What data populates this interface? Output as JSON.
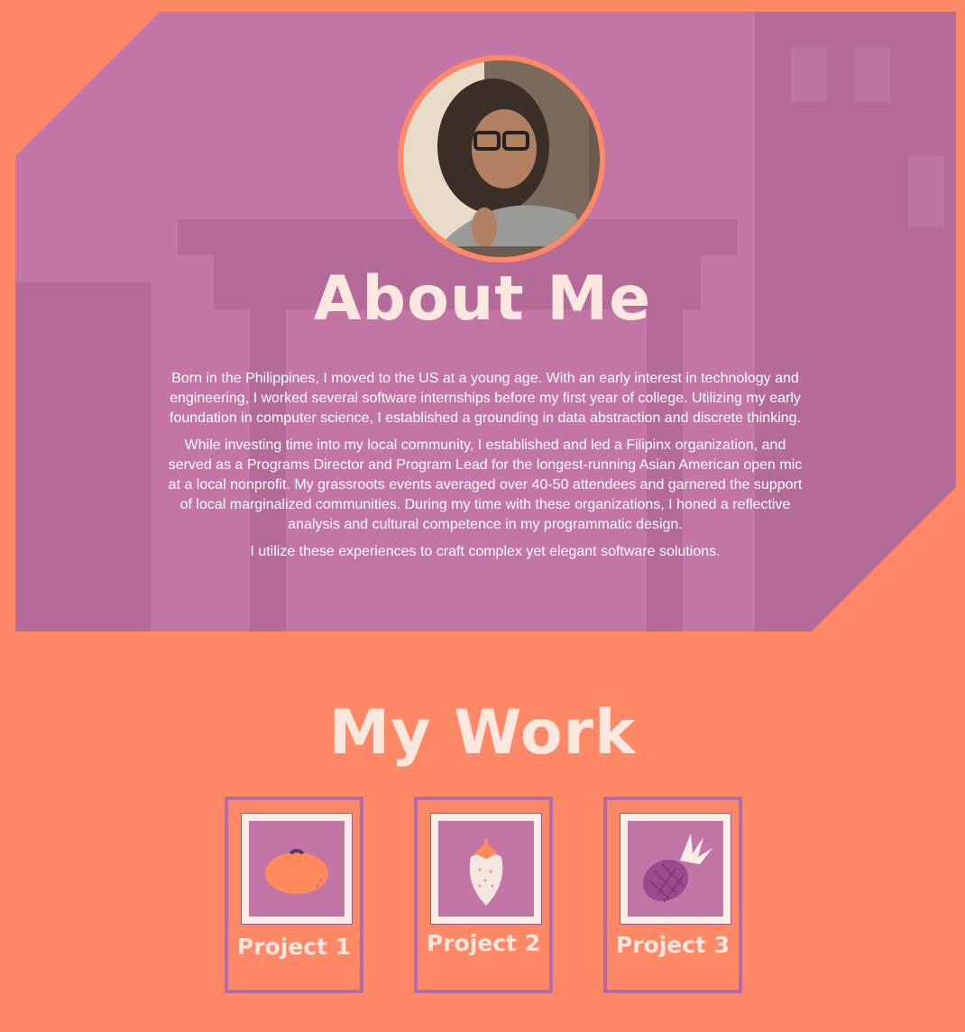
{
  "about": {
    "title": "About Me",
    "paragraphs": [
      "Born in the Philippines, I moved to the US at a young age. With an early interest in technology and engineering, I worked several software internships before my first year of college. Utilizing my early foundation in computer science, I established a grounding in data abstraction and discrete thinking.",
      "While investing time into my local community, I established and led a Filipinx organization, and served as a Programs Director and Program Lead for the longest-running Asian American open mic at a local nonprofit. My grassroots events averaged over 40-50 attendees and garnered the support of local marginalized communities. During my time with these organizations, I honed a reflective analysis and cultural competence in my programmatic design.",
      "I utilize these experiences to craft complex yet elegant software solutions."
    ]
  },
  "work": {
    "title": "My Work",
    "projects": [
      {
        "label": "Project 1",
        "icon": "orange-icon"
      },
      {
        "label": "Project 2",
        "icon": "strawberry-icon"
      },
      {
        "label": "Project 3",
        "icon": "pineapple-icon"
      }
    ]
  },
  "colors": {
    "background": "#ff8866",
    "hero_overlay": "#c376a6",
    "title_text": "#fce8df",
    "card_border": "#b36aa8"
  }
}
